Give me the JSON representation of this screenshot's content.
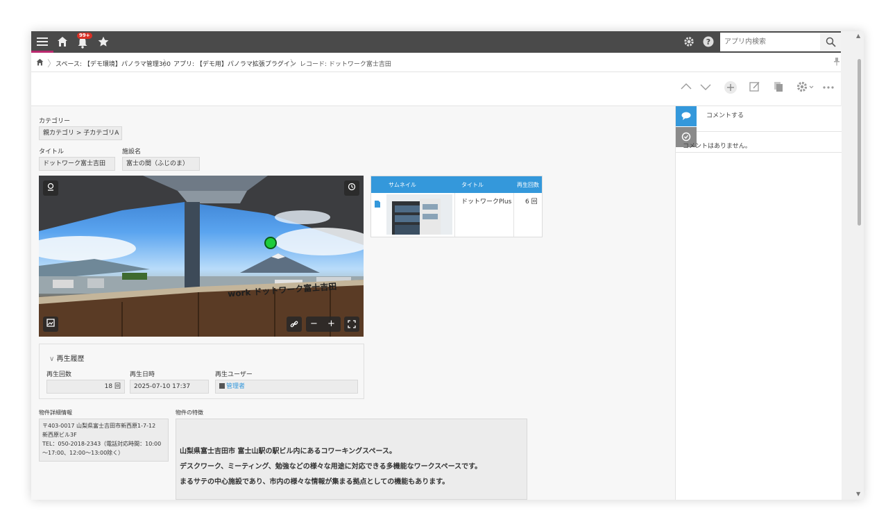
{
  "header": {
    "notification_count": "99+",
    "search_placeholder": "アプリ内検索"
  },
  "breadcrumb": {
    "space": "スペース: 【デモ環境】パノラマ管理360",
    "app": "アプリ: 【デモ用】パノラマ拡張プラグイン",
    "record": "レコード: ドットワーク富士吉田"
  },
  "fields": {
    "category_label": "カテゴリー",
    "category_value": "親カテゴリ > 子カテゴリA",
    "title_label": "タイトル",
    "title_value": "ドットワーク富士吉田",
    "facility_label": "施設名",
    "facility_value": "富士の間（ふじのま）"
  },
  "panorama": {
    "sign_text": "work ドットワーク富士吉田"
  },
  "thumb_table": {
    "headers": [
      "サムネイル",
      "タイトル",
      "再生回数"
    ],
    "rows": [
      {
        "title": "ドットワークPlus",
        "plays": "6 回"
      }
    ]
  },
  "history": {
    "section_title": "再生履歴",
    "count_label": "再生回数",
    "count_value": "18 回",
    "datetime_label": "再生日時",
    "datetime_value": "2025-07-10 17:37",
    "user_label": "再生ユーザー",
    "user_value": "管理者"
  },
  "property": {
    "detail_label": "物件詳細情報",
    "detail_lines": [
      "〒403-0017 山梨県富士吉田市新西原1-7-12",
      "新西原ビル3F",
      "TEL：050-2018-2343（電話対応時間：10:00",
      "～17:00、12:00～13:00除く）"
    ],
    "feature_label": "物件の特徴",
    "feature_lines": [
      "山梨県富士吉田市 富士山駅の駅ビル内にあるコワーキングスペース。",
      "デスクワーク、ミーティング、勉強などの様々な用途に対応できる多機能なワークスペースです。",
      "まるサテの中心施設であり、市内の様々な情報が集まる拠点としての機能もあります。"
    ]
  },
  "comments": {
    "placeholder": "コメントする",
    "empty": "コメントはありません。"
  },
  "colors": {
    "header_bg": "#4a4a4a",
    "accent_blue": "#3498db",
    "badge_red": "#d93025",
    "hotspot_green": "#1ecc3c"
  }
}
